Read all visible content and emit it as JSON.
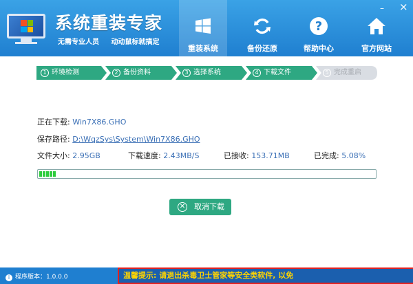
{
  "app": {
    "title": "系统重装专家",
    "slogan_1": "无需专业人员",
    "slogan_2": "动动鼠标就搞定",
    "min_glyph": "–",
    "close_glyph": "×"
  },
  "nav": [
    {
      "label": "重装系统",
      "icon": "windows-icon",
      "active": true
    },
    {
      "label": "备份还原",
      "icon": "refresh-icon",
      "active": false
    },
    {
      "label": "帮助中心",
      "icon": "help-icon",
      "active": false
    },
    {
      "label": "官方网站",
      "icon": "home-icon",
      "active": false
    }
  ],
  "steps": [
    {
      "num": "1",
      "label": "环境检测",
      "state": "done"
    },
    {
      "num": "2",
      "label": "备份资料",
      "state": "done"
    },
    {
      "num": "3",
      "label": "选择系统",
      "state": "done"
    },
    {
      "num": "4",
      "label": "下载文件",
      "state": "current"
    },
    {
      "num": "5",
      "label": "完成重启",
      "state": "pending"
    }
  ],
  "download": {
    "downloading_label": "正在下载:",
    "file_name": "Win7X86.GHO",
    "save_path_label": "保存路径:",
    "save_path": "D:\\WqzSys\\System\\Win7X86.GHO",
    "size_label": "文件大小:",
    "size_value": "2.95GB",
    "speed_label": "下载速度:",
    "speed_value": "2.43MB/S",
    "received_label": "已接收:",
    "received_value": "153.71MB",
    "completed_label": "已完成:",
    "completed_value": "5.08%",
    "progress_percent": 5.08
  },
  "buttons": {
    "cancel_label": "取消下载"
  },
  "footer": {
    "version": "程序版本：1.0.0.0",
    "notice": "温馨提示: 请退出杀毒卫士管家等安全类软件, 以免"
  },
  "colors": {
    "header_blue": "#1f7fd0",
    "step_green": "#2ea882",
    "step_pending": "#d9dde3",
    "progress_green": "#2ecc3e",
    "notice_yellow": "#ffd400"
  }
}
